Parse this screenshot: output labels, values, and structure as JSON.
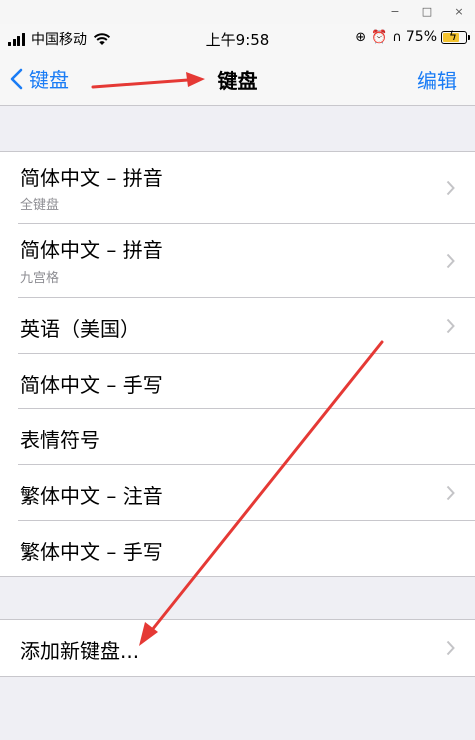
{
  "window": {
    "minimize": "−",
    "maximize": "□",
    "close": "×"
  },
  "status": {
    "carrier": "中国移动",
    "time": "上午9:58",
    "battery": "75%",
    "battery_level": 0.75
  },
  "nav": {
    "back_label": "键盘",
    "title": "键盘",
    "edit_label": "编辑"
  },
  "keyboards": [
    {
      "title": "简体中文 – 拼音",
      "subtitle": "全键盘"
    },
    {
      "title": "简体中文 – 拼音",
      "subtitle": "九宫格"
    },
    {
      "title": "英语（美国）"
    },
    {
      "title": "简体中文 – 手写"
    },
    {
      "title": "表情符号"
    },
    {
      "title": "繁体中文 – 注音"
    },
    {
      "title": "繁体中文 – 手写"
    }
  ],
  "add_keyboard": {
    "label": "添加新键盘..."
  },
  "colors": {
    "accent": "#1a7cf5",
    "annotation": "#e53935",
    "battery": "#f4c430"
  }
}
